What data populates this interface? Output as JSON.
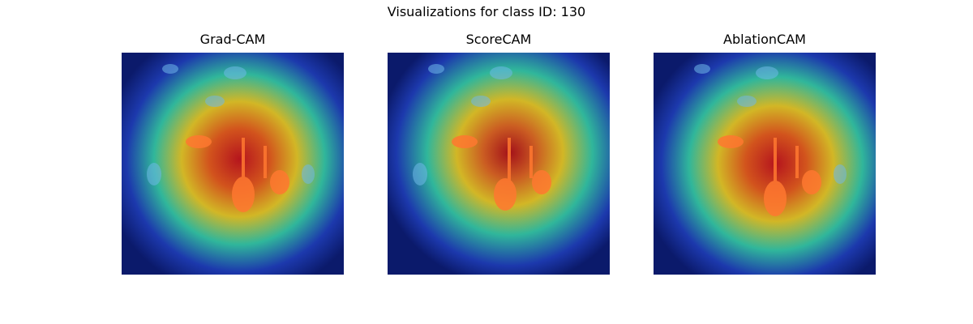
{
  "figure": {
    "title": "Visualizations for class ID: 130"
  },
  "panels": [
    {
      "title": "Grad-CAM"
    },
    {
      "title": "ScoreCAM"
    },
    {
      "title": "AblationCAM"
    }
  ],
  "colors": {
    "background_water": "#0b1a6b",
    "heat_hot": "#c81414",
    "heat_warm": "#e8c81e",
    "heat_mid": "#34c8a0",
    "heat_cool": "#1e3cb4",
    "flamingo": "#ff7830"
  }
}
